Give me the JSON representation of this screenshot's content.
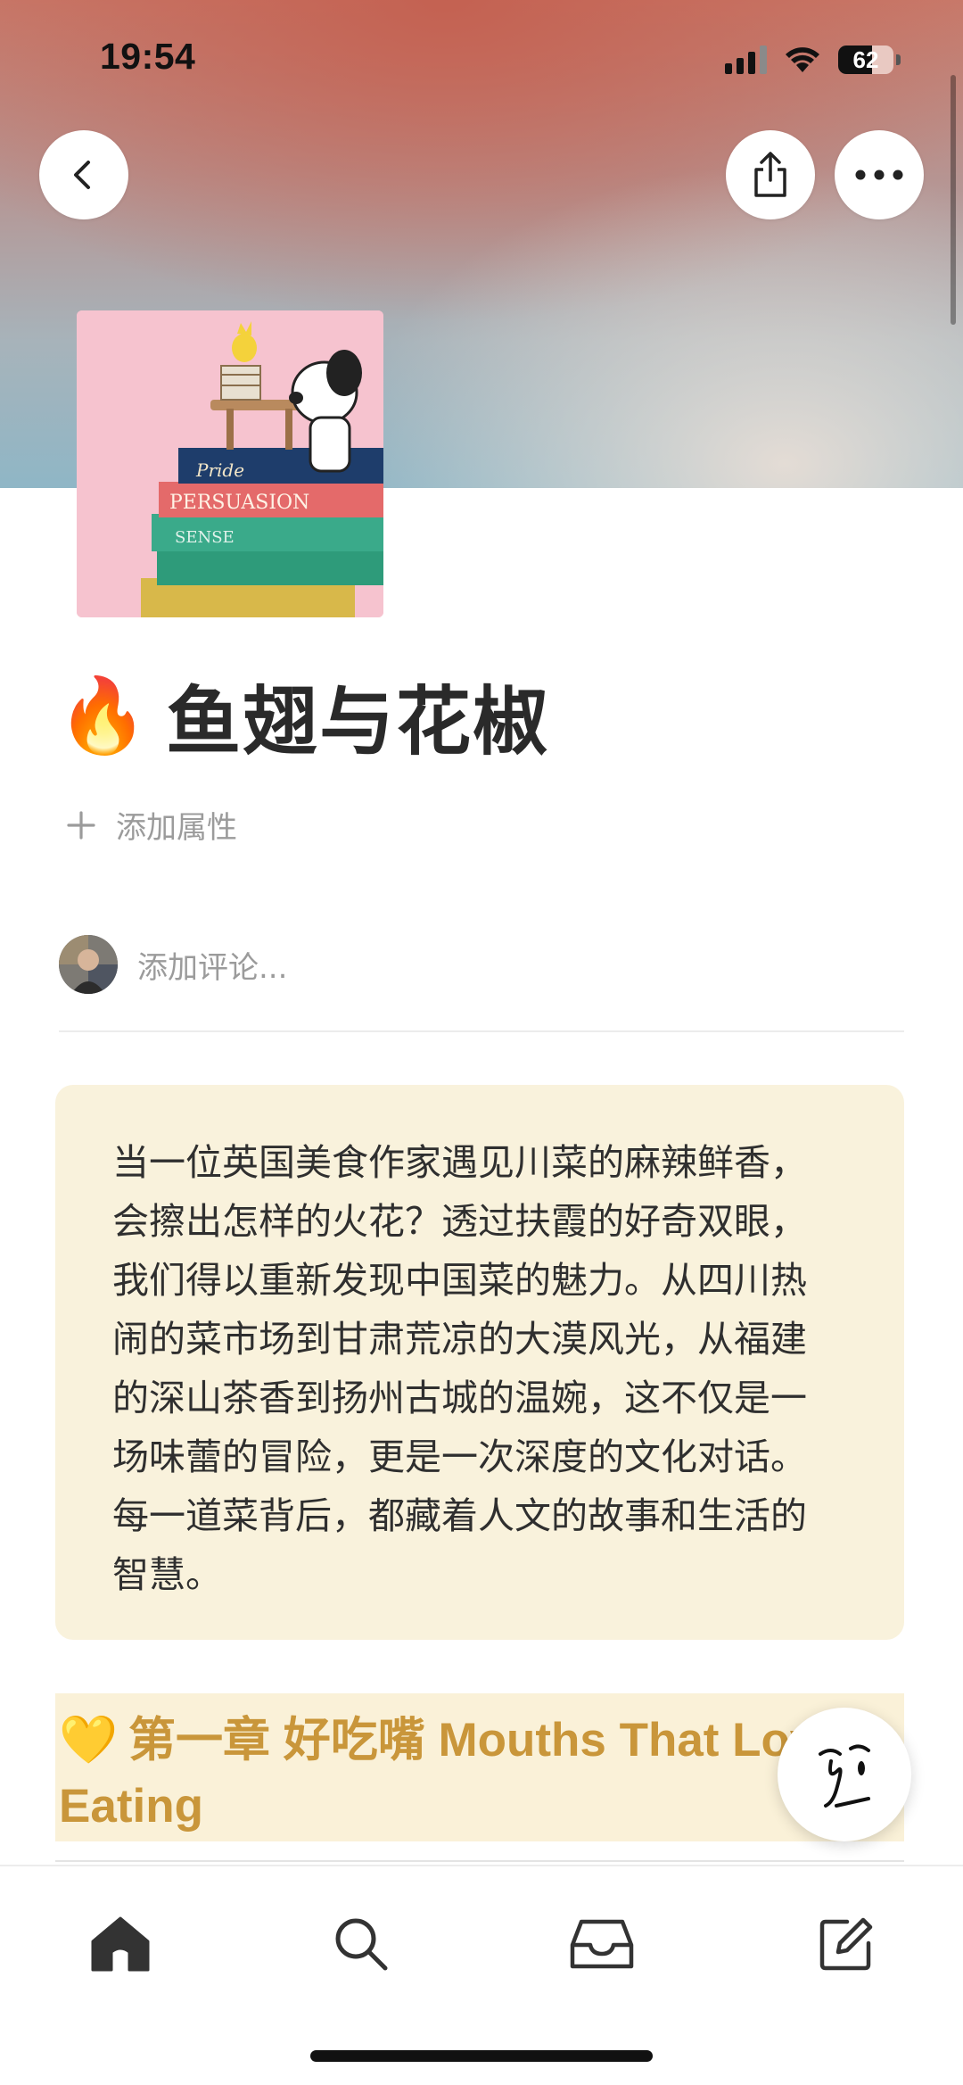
{
  "status_bar": {
    "time": "19:54",
    "battery_percent": "62",
    "battery_level": 0.62
  },
  "header": {
    "back_icon": "chevron-left-icon",
    "share_icon": "share-icon",
    "more_icon": "more-horizontal-icon"
  },
  "page": {
    "title_emoji": "🔥",
    "title": "鱼翅与花椒",
    "add_property_label": "添加属性",
    "comment_placeholder": "添加评论..."
  },
  "callout": {
    "background": "#f9f2dc",
    "text": "当一位英国美食作家遇见川菜的麻辣鲜香，会擦出怎样的火花？透过扶霞的好奇双眼，我们得以重新发现中国菜的魅力。从四川热闹的菜市场到甘肃荒凉的大漠风光，从福建的深山茶香到扬州古城的温婉，这不仅是一场味蕾的冒险，更是一次深度的文化对话。每一道菜背后，都藏着人文的故事和生活的智慧。"
  },
  "chapter_heading": {
    "emoji": "💛",
    "text": "第一章 好吃嘴 Mouths That Love Eating",
    "color": "#c9963a",
    "background": "#faf1d8"
  },
  "tabbar": {
    "items": [
      {
        "icon": "home-icon"
      },
      {
        "icon": "search-icon"
      },
      {
        "icon": "inbox-icon"
      },
      {
        "icon": "compose-icon"
      }
    ]
  }
}
